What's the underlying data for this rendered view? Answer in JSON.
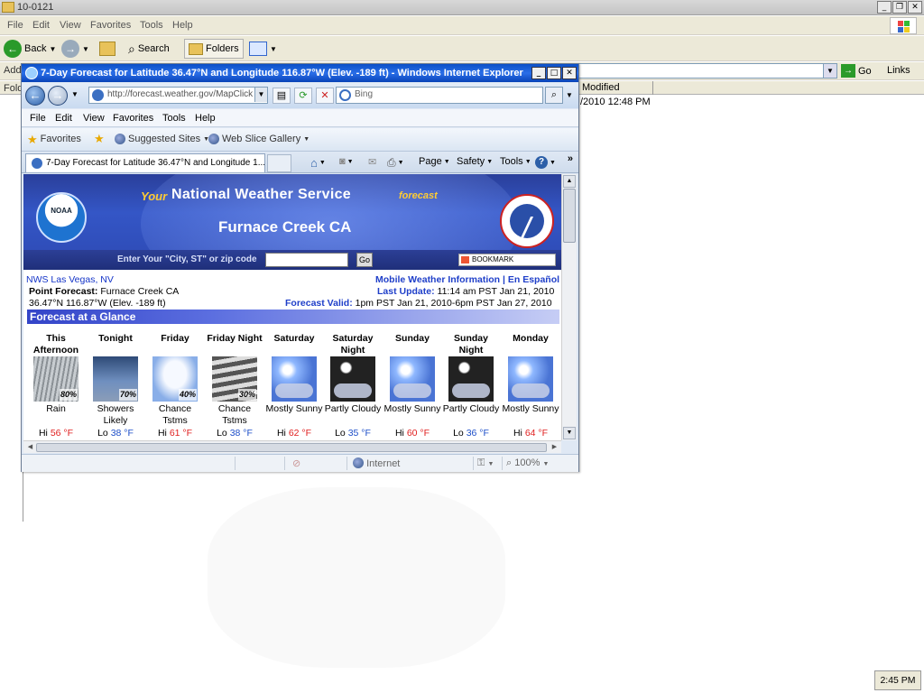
{
  "explorer": {
    "title": "10-0121",
    "menu": [
      "File",
      "Edit",
      "View",
      "Favorites",
      "Tools",
      "Help"
    ],
    "toolbar": {
      "back": "Back",
      "search": "Search",
      "folders": "Folders"
    },
    "address_label": "Addr",
    "go": "Go",
    "links": "Links",
    "left_header": "Fold",
    "column_modified": "Modified",
    "file_date": "/2010 12:48 PM"
  },
  "ie": {
    "title": "7-Day Forecast for Latitude 36.47°N and Longitude 116.87°W (Elev. -189 ft) - Windows Internet Explorer",
    "url": "http://forecast.weather.gov/MapClick",
    "search_placeholder": "Bing",
    "menu": [
      "File",
      "Edit",
      "View",
      "Favorites",
      "Tools",
      "Help"
    ],
    "favorites": {
      "favorites": "Favorites",
      "suggested": "Suggested Sites",
      "webslice": "Web Slice Gallery"
    },
    "tab_title": "7-Day Forecast for Latitude 36.47°N and Longitude 1...",
    "commands": {
      "page": "Page",
      "safety": "Safety",
      "tools": "Tools"
    },
    "status": {
      "zone": "Internet",
      "zoom": "100%"
    }
  },
  "page": {
    "your": "Your",
    "header": "National Weather Service",
    "forecast_word": "forecast",
    "location": "Furnace Creek CA",
    "search_label": "Enter Your \"City, ST\" or zip code",
    "go": "Go",
    "bookmark": "BOOKMARK",
    "office": "NWS Las Vegas, NV",
    "point_label": "Point Forecast:",
    "point_value": "Furnace Creek CA",
    "coords": "36.47°N 116.87°W (Elev. -189 ft)",
    "mobile_link": "Mobile Weather Information",
    "separator": "|",
    "espanol_link": "En Español",
    "last_update_label": "Last Update:",
    "last_update_value": "11:14 am PST Jan 21, 2010",
    "valid_label": "Forecast Valid:",
    "valid_value": "1pm PST Jan 21, 2010-6pm PST Jan 27, 2010",
    "glance": "Forecast at a Glance",
    "periods": [
      {
        "period": "This Afternoon",
        "img": "rain",
        "pct": "80%",
        "desc": "Rain",
        "temp_label": "Hi",
        "temp": "56 °F",
        "hl": "hi"
      },
      {
        "period": "Tonight",
        "img": "shower",
        "pct": "70%",
        "desc": "Showers Likely",
        "temp_label": "Lo",
        "temp": "38 °F",
        "hl": "lo"
      },
      {
        "period": "Friday",
        "img": "tstm",
        "pct": "40%",
        "desc": "Chance Tstms",
        "temp_label": "Hi",
        "temp": "61 °F",
        "hl": "hi"
      },
      {
        "period": "Friday Night",
        "img": "tstmn",
        "pct": "30%",
        "desc": "Chance Tstms",
        "temp_label": "Lo",
        "temp": "38 °F",
        "hl": "lo"
      },
      {
        "period": "Saturday",
        "img": "sun",
        "pct": "",
        "desc": "Mostly Sunny",
        "temp_label": "Hi",
        "temp": "62 °F",
        "hl": "hi"
      },
      {
        "period": "Saturday Night",
        "img": "night",
        "pct": "",
        "desc": "Partly Cloudy",
        "temp_label": "Lo",
        "temp": "35 °F",
        "hl": "lo"
      },
      {
        "period": "Sunday",
        "img": "sun",
        "pct": "",
        "desc": "Mostly Sunny",
        "temp_label": "Hi",
        "temp": "60 °F",
        "hl": "hi"
      },
      {
        "period": "Sunday Night",
        "img": "night",
        "pct": "",
        "desc": "Partly Cloudy",
        "temp_label": "Lo",
        "temp": "36 °F",
        "hl": "lo"
      },
      {
        "period": "Monday",
        "img": "sun",
        "pct": "",
        "desc": "Mostly Sunny",
        "temp_label": "Hi",
        "temp": "64 °F",
        "hl": "hi"
      }
    ]
  },
  "taskbar": {
    "clock": "2:45 PM"
  }
}
